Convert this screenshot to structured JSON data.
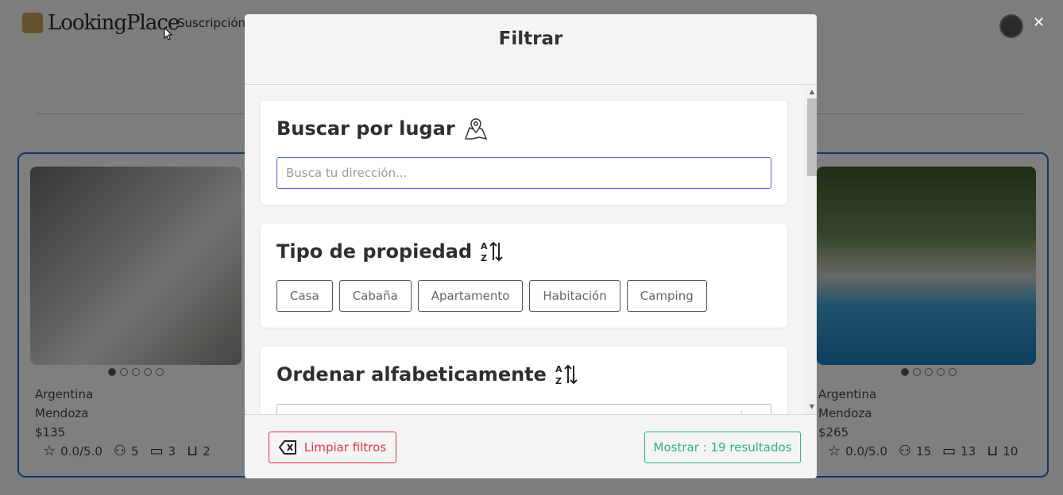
{
  "background": {
    "logo_text": "LookingPlace",
    "nav_link": "Suscripción",
    "cards": [
      {
        "country": "Argentina",
        "city": "Mendoza",
        "price": "$135",
        "rating": "0.0/5.0",
        "guests": "5",
        "beds": "3",
        "baths": "2"
      },
      {
        "country": "Argentina",
        "city": "Mendoza",
        "price": "$265",
        "rating": "0.0/5.0",
        "guests": "15",
        "beds": "13",
        "baths": "10"
      }
    ]
  },
  "modal": {
    "title": "Filtrar",
    "sections": {
      "place": {
        "title": "Buscar por lugar",
        "placeholder": "Busca tu dirección...",
        "icon": "map-pin-icon"
      },
      "type": {
        "title": "Tipo de propiedad",
        "icon": "sort-az-icon",
        "options": [
          "Casa",
          "Cabaña",
          "Apartamento",
          "Habitación",
          "Camping"
        ]
      },
      "sort": {
        "title": "Ordenar alfabeticamente",
        "icon": "sort-az-icon"
      }
    },
    "footer": {
      "clear_label": "Limpiar filtros",
      "show_label": "Mostrar : 19 resultados"
    }
  },
  "colors": {
    "danger": "#dc3545",
    "success": "#2fb37a",
    "input_focus": "#4c63c7",
    "card_border": "#1e6fd9"
  }
}
